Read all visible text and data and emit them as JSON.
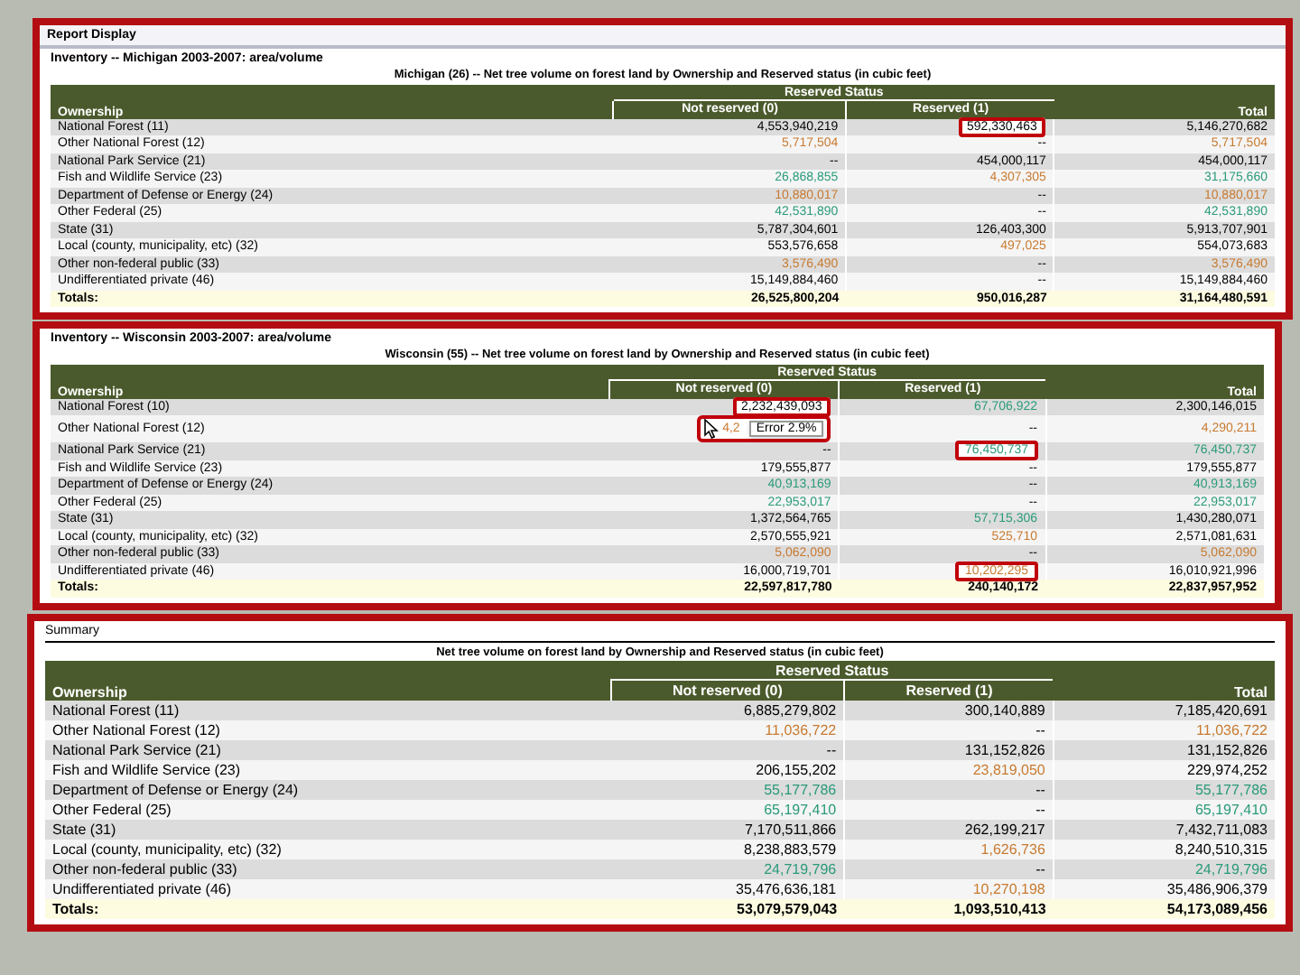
{
  "window": {
    "title": "Report Display"
  },
  "sections": [
    {
      "title": "Inventory -- Michigan 2003-2007: area/volume",
      "caption": "Michigan (26) -- Net tree volume on forest land by Ownership and Reserved status (in cubic feet)",
      "table": {
        "group": "Reserved Status",
        "row_header": "Ownership",
        "columns": [
          "Not reserved (0)",
          "Reserved (1)",
          "Total"
        ],
        "rows": [
          {
            "label": "National Forest (11)",
            "cells": [
              {
                "text": "4,553,940,219",
                "color": "#000000",
                "highlighted": false
              },
              {
                "text": "592,330,463",
                "color": "#000000",
                "highlighted": true
              },
              {
                "text": "5,146,270,682",
                "color": "#000000",
                "highlighted": false
              }
            ]
          },
          {
            "label": "Other National Forest (12)",
            "cells": [
              {
                "text": "5,717,504",
                "color": "#c87a30",
                "highlighted": false
              },
              {
                "text": "--",
                "highlighted": false
              },
              {
                "text": "5,717,504",
                "color": "#c87a30",
                "highlighted": false
              }
            ]
          },
          {
            "label": "National Park Service (21)",
            "cells": [
              {
                "text": "--",
                "highlighted": false
              },
              {
                "text": "454,000,117",
                "color": "#000000",
                "highlighted": false
              },
              {
                "text": "454,000,117",
                "color": "#000000",
                "highlighted": false
              }
            ]
          },
          {
            "label": "Fish and Wildlife Service (23)",
            "cells": [
              {
                "text": "26,868,855",
                "color": "#2a9a7a",
                "highlighted": false
              },
              {
                "text": "4,307,305",
                "color": "#c87a30",
                "highlighted": false
              },
              {
                "text": "31,175,660",
                "color": "#2a9a7a",
                "highlighted": false
              }
            ]
          },
          {
            "label": "Department of Defense or Energy (24)",
            "cells": [
              {
                "text": "10,880,017",
                "color": "#c87a30",
                "highlighted": false
              },
              {
                "text": "--",
                "highlighted": false
              },
              {
                "text": "10,880,017",
                "color": "#c87a30",
                "highlighted": false
              }
            ]
          },
          {
            "label": "Other Federal (25)",
            "cells": [
              {
                "text": "42,531,890",
                "color": "#2a9a7a",
                "highlighted": false
              },
              {
                "text": "--",
                "highlighted": false
              },
              {
                "text": "42,531,890",
                "color": "#2a9a7a",
                "highlighted": false
              }
            ]
          },
          {
            "label": "State (31)",
            "cells": [
              {
                "text": "5,787,304,601",
                "color": "#000000",
                "highlighted": false
              },
              {
                "text": "126,403,300",
                "color": "#000000",
                "highlighted": false
              },
              {
                "text": "5,913,707,901",
                "color": "#000000",
                "highlighted": false
              }
            ]
          },
          {
            "label": "Local (county, municipality, etc) (32)",
            "cells": [
              {
                "text": "553,576,658",
                "color": "#000000",
                "highlighted": false
              },
              {
                "text": "497,025",
                "color": "#c87a30",
                "highlighted": false
              },
              {
                "text": "554,073,683",
                "color": "#000000",
                "highlighted": false
              }
            ]
          },
          {
            "label": "Other non-federal public (33)",
            "cells": [
              {
                "text": "3,576,490",
                "color": "#c87a30",
                "highlighted": false
              },
              {
                "text": "--",
                "highlighted": false
              },
              {
                "text": "3,576,490",
                "color": "#c87a30",
                "highlighted": false
              }
            ]
          },
          {
            "label": "Undifferentiated private (46)",
            "cells": [
              {
                "text": "15,149,884,460",
                "color": "#000000",
                "highlighted": false
              },
              {
                "text": "--",
                "highlighted": false
              },
              {
                "text": "15,149,884,460",
                "color": "#000000",
                "highlighted": false
              }
            ]
          }
        ],
        "totals": {
          "label": "Totals:",
          "cells": [
            "26,525,800,204",
            "950,016,287",
            "31,164,480,591"
          ]
        }
      }
    },
    {
      "title": "Inventory -- Wisconsin 2003-2007: area/volume",
      "caption": "Wisconsin (55) -- Net tree volume on forest land by Ownership and Reserved status (in cubic feet)",
      "table": {
        "group": "Reserved Status",
        "row_header": "Ownership",
        "columns": [
          "Not reserved (0)",
          "Reserved (1)",
          "Total"
        ],
        "rows": [
          {
            "label": "National Forest (10)",
            "cells": [
              {
                "text": "2,232,439,093",
                "color": "#000000",
                "highlighted": true
              },
              {
                "text": "67,706,922",
                "color": "#2a9a7a",
                "highlighted": false
              },
              {
                "text": "2,300,146,015",
                "color": "#000000",
                "highlighted": false
              }
            ]
          },
          {
            "label": "Other National Forest (12)",
            "cells": [
              {
                "text": "4,2",
                "color": "#c87a30",
                "highlighted": false,
                "tooltip": {
                  "text": "Error 2.9%",
                  "highlighted": true
                }
              },
              {
                "text": "--",
                "highlighted": false
              },
              {
                "text": "4,290,211",
                "color": "#c87a30",
                "highlighted": false
              }
            ]
          },
          {
            "label": "National Park Service (21)",
            "cells": [
              {
                "text": "--",
                "highlighted": false
              },
              {
                "text": "76,450,737",
                "color": "#2a9a7a",
                "highlighted": true
              },
              {
                "text": "76,450,737",
                "color": "#2a9a7a",
                "highlighted": false
              }
            ]
          },
          {
            "label": "Fish and Wildlife Service (23)",
            "cells": [
              {
                "text": "179,555,877",
                "color": "#000000",
                "highlighted": false
              },
              {
                "text": "--",
                "highlighted": false
              },
              {
                "text": "179,555,877",
                "color": "#000000",
                "highlighted": false
              }
            ]
          },
          {
            "label": "Department of Defense or Energy (24)",
            "cells": [
              {
                "text": "40,913,169",
                "color": "#2a9a7a",
                "highlighted": false
              },
              {
                "text": "--",
                "highlighted": false
              },
              {
                "text": "40,913,169",
                "color": "#2a9a7a",
                "highlighted": false
              }
            ]
          },
          {
            "label": "Other Federal (25)",
            "cells": [
              {
                "text": "22,953,017",
                "color": "#2a9a7a",
                "highlighted": false
              },
              {
                "text": "--",
                "highlighted": false
              },
              {
                "text": "22,953,017",
                "color": "#2a9a7a",
                "highlighted": false
              }
            ]
          },
          {
            "label": "State (31)",
            "cells": [
              {
                "text": "1,372,564,765",
                "color": "#000000",
                "highlighted": false
              },
              {
                "text": "57,715,306",
                "color": "#2a9a7a",
                "highlighted": false
              },
              {
                "text": "1,430,280,071",
                "color": "#000000",
                "highlighted": false
              }
            ]
          },
          {
            "label": "Local (county, municipality, etc) (32)",
            "cells": [
              {
                "text": "2,570,555,921",
                "color": "#000000",
                "highlighted": false
              },
              {
                "text": "525,710",
                "color": "#c87a30",
                "highlighted": false
              },
              {
                "text": "2,571,081,631",
                "color": "#000000",
                "highlighted": false
              }
            ]
          },
          {
            "label": "Other non-federal public (33)",
            "cells": [
              {
                "text": "5,062,090",
                "color": "#c87a30",
                "highlighted": false
              },
              {
                "text": "--",
                "highlighted": false
              },
              {
                "text": "5,062,090",
                "color": "#c87a30",
                "highlighted": false
              }
            ]
          },
          {
            "label": "Undifferentiated private (46)",
            "cells": [
              {
                "text": "16,000,719,701",
                "color": "#000000",
                "highlighted": false
              },
              {
                "text": "10,202,295",
                "color": "#c87a30",
                "highlighted": true
              },
              {
                "text": "16,010,921,996",
                "color": "#000000",
                "highlighted": false
              }
            ]
          }
        ],
        "totals": {
          "label": "Totals:",
          "cells": [
            "22,597,817,780",
            "240,140,172",
            "22,837,957,952"
          ]
        }
      }
    },
    {
      "title": "Summary",
      "caption": "Net tree volume on forest land by Ownership and Reserved status (in cubic feet)",
      "table": {
        "group": "Reserved Status",
        "row_header": "Ownership",
        "columns": [
          "Not reserved (0)",
          "Reserved (1)",
          "Total"
        ],
        "rows": [
          {
            "label": "National Forest (11)",
            "cells": [
              {
                "text": "6,885,279,802",
                "color": "#000000",
                "highlighted": false
              },
              {
                "text": "300,140,889",
                "color": "#000000",
                "highlighted": false
              },
              {
                "text": "7,185,420,691",
                "color": "#000000",
                "highlighted": false
              }
            ]
          },
          {
            "label": "Other National Forest (12)",
            "cells": [
              {
                "text": "11,036,722",
                "color": "#c87a30",
                "highlighted": false
              },
              {
                "text": "--",
                "highlighted": false
              },
              {
                "text": "11,036,722",
                "color": "#c87a30",
                "highlighted": false
              }
            ]
          },
          {
            "label": "National Park Service (21)",
            "cells": [
              {
                "text": "--",
                "highlighted": false
              },
              {
                "text": "131,152,826",
                "color": "#000000",
                "highlighted": false
              },
              {
                "text": "131,152,826",
                "color": "#000000",
                "highlighted": false
              }
            ]
          },
          {
            "label": "Fish and Wildlife Service (23)",
            "cells": [
              {
                "text": "206,155,202",
                "color": "#000000",
                "highlighted": false
              },
              {
                "text": "23,819,050",
                "color": "#c87a30",
                "highlighted": false
              },
              {
                "text": "229,974,252",
                "color": "#000000",
                "highlighted": false
              }
            ]
          },
          {
            "label": "Department of Defense or Energy (24)",
            "cells": [
              {
                "text": "55,177,786",
                "color": "#2a9a7a",
                "highlighted": false
              },
              {
                "text": "--",
                "highlighted": false
              },
              {
                "text": "55,177,786",
                "color": "#2a9a7a",
                "highlighted": false
              }
            ]
          },
          {
            "label": "Other Federal (25)",
            "cells": [
              {
                "text": "65,197,410",
                "color": "#2a9a7a",
                "highlighted": false
              },
              {
                "text": "--",
                "highlighted": false
              },
              {
                "text": "65,197,410",
                "color": "#2a9a7a",
                "highlighted": false
              }
            ]
          },
          {
            "label": "State (31)",
            "cells": [
              {
                "text": "7,170,511,866",
                "color": "#000000",
                "highlighted": false
              },
              {
                "text": "262,199,217",
                "color": "#000000",
                "highlighted": false
              },
              {
                "text": "7,432,711,083",
                "color": "#000000",
                "highlighted": false
              }
            ]
          },
          {
            "label": "Local (county, municipality, etc) (32)",
            "cells": [
              {
                "text": "8,238,883,579",
                "color": "#000000",
                "highlighted": false
              },
              {
                "text": "1,626,736",
                "color": "#c87a30",
                "highlighted": false
              },
              {
                "text": "8,240,510,315",
                "color": "#000000",
                "highlighted": false
              }
            ]
          },
          {
            "label": "Other non-federal public (33)",
            "cells": [
              {
                "text": "24,719,796",
                "color": "#2a9a7a",
                "highlighted": false
              },
              {
                "text": "--",
                "highlighted": false
              },
              {
                "text": "24,719,796",
                "color": "#2a9a7a",
                "highlighted": false
              }
            ]
          },
          {
            "label": "Undifferentiated private (46)",
            "cells": [
              {
                "text": "35,476,636,181",
                "color": "#000000",
                "highlighted": false
              },
              {
                "text": "10,270,198",
                "color": "#c87a30",
                "highlighted": false
              },
              {
                "text": "35,486,906,379",
                "color": "#000000",
                "highlighted": false
              }
            ]
          }
        ],
        "totals": {
          "label": "Totals:",
          "cells": [
            "53,079,579,043",
            "1,093,510,413",
            "54,173,089,456"
          ]
        }
      }
    }
  ]
}
